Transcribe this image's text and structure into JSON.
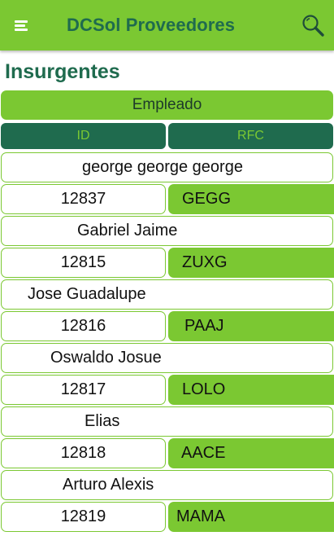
{
  "app": {
    "title": "DCSol Proveedores",
    "menu_icon": "menu-icon",
    "search_icon": "search-icon",
    "colors": {
      "primary": "#7bc832",
      "dark": "#1f6b4e"
    }
  },
  "page": {
    "section_title": "Insurgentes",
    "table_title": "Empleado",
    "columns": {
      "id": "ID",
      "rfc": "RFC"
    }
  },
  "employees": [
    {
      "name": "george george george",
      "id": "12837",
      "rfc": "GEGG"
    },
    {
      "name": "Gabriel Jaime",
      "id": "12815",
      "rfc": "ZUXG"
    },
    {
      "name": "Jose Guadalupe",
      "id": "12816",
      "rfc": "PAAJ"
    },
    {
      "name": "Oswaldo Josue",
      "id": "12817",
      "rfc": "LOLO"
    },
    {
      "name": "Elias",
      "id": "12818",
      "rfc": "AACE"
    },
    {
      "name": "Arturo Alexis",
      "id": "12819",
      "rfc": "MAMA"
    }
  ]
}
